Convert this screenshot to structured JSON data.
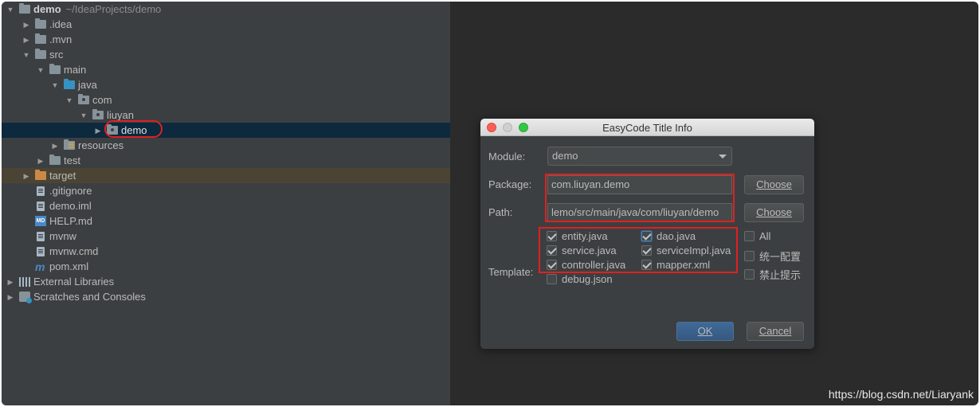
{
  "tree": {
    "root": {
      "label": "demo",
      "path": "~/IdeaProjects/demo"
    },
    "items": [
      {
        "label": ".idea"
      },
      {
        "label": ".mvn"
      },
      {
        "label": "src"
      },
      {
        "label": "main"
      },
      {
        "label": "java"
      },
      {
        "label": "com"
      },
      {
        "label": "liuyan"
      },
      {
        "label": "demo"
      },
      {
        "label": "resources"
      },
      {
        "label": "test"
      },
      {
        "label": "target"
      },
      {
        "label": ".gitignore"
      },
      {
        "label": "demo.iml"
      },
      {
        "label": "HELP.md"
      },
      {
        "label": "mvnw"
      },
      {
        "label": "mvnw.cmd"
      },
      {
        "label": "pom.xml"
      },
      {
        "label": "External Libraries"
      },
      {
        "label": "Scratches and Consoles"
      }
    ]
  },
  "dialog": {
    "title": "EasyCode Title Info",
    "module_label": "Module:",
    "module_value": "demo",
    "package_label": "Package:",
    "package_value": "com.liuyan.demo",
    "path_label": "Path:",
    "path_value": "lemo/src/main/java/com/liuyan/demo",
    "choose_label": "Choose",
    "template_label": "Template:",
    "templates": [
      {
        "label": "entity.java",
        "checked": true
      },
      {
        "label": "dao.java",
        "checked": true
      },
      {
        "label": "service.java",
        "checked": true
      },
      {
        "label": "serviceImpl.java",
        "checked": true
      },
      {
        "label": "controller.java",
        "checked": true
      },
      {
        "label": "mapper.xml",
        "checked": true
      },
      {
        "label": "debug.json",
        "checked": false
      }
    ],
    "options": [
      {
        "label": "All",
        "checked": false
      },
      {
        "label": "统一配置",
        "checked": false
      },
      {
        "label": "禁止提示",
        "checked": false
      }
    ],
    "ok_label": "OK",
    "cancel_label": "Cancel"
  },
  "watermark": "https://blog.csdn.net/Liaryank",
  "colors": {
    "tree_bg": "#3c3f41",
    "selection": "#0d293e",
    "excluded": "#4b4434",
    "highlight_red": "#e02020",
    "folder_blue": "#3592c4"
  }
}
